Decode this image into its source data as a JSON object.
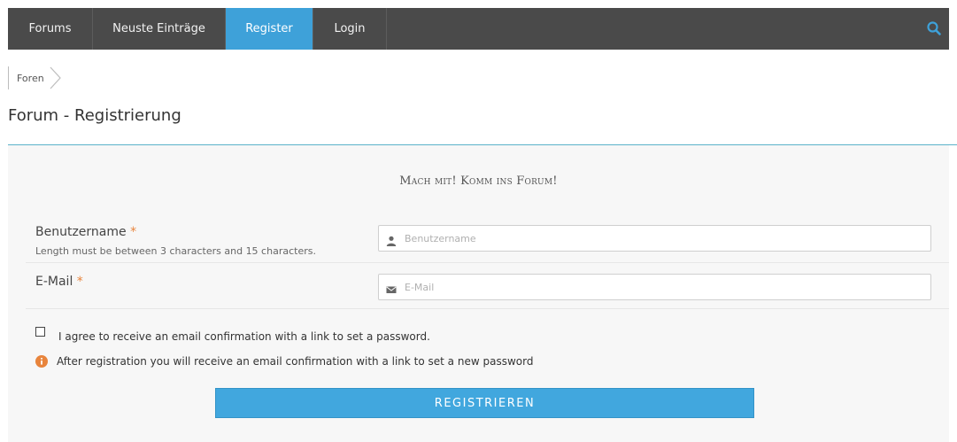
{
  "nav": {
    "items": [
      {
        "label": "Forums",
        "active": false
      },
      {
        "label": "Neuste Einträge",
        "active": false
      },
      {
        "label": "Register",
        "active": true
      },
      {
        "label": "Login",
        "active": false
      }
    ],
    "search_icon": "search-icon",
    "bar_color": "#4a4a4a",
    "active_color": "#3ea1d9"
  },
  "breadcrumb": {
    "label": "Foren"
  },
  "page": {
    "title": "Forum - Registrierung"
  },
  "form": {
    "heading": "Mach mit! Komm ins Forum!",
    "username": {
      "label": "Benutzername",
      "required_mark": "*",
      "hint": "Length must be between 3 characters and 15 characters.",
      "placeholder": "Benutzername",
      "value": "",
      "icon": "user-icon"
    },
    "email": {
      "label": "E-Mail",
      "required_mark": "*",
      "placeholder": "E-Mail",
      "value": "",
      "icon": "envelope-icon"
    },
    "consent": {
      "label": "I agree to receive an email confirmation with a link to set a password.",
      "checked": false
    },
    "info": {
      "text": "After registration you will receive an email confirmation with a link to set a new password",
      "icon": "info-icon",
      "icon_color": "#e8843c"
    },
    "submit_label": "REGISTRIEREN",
    "submit_color": "#41a7de",
    "required_color": "#e8843c"
  }
}
